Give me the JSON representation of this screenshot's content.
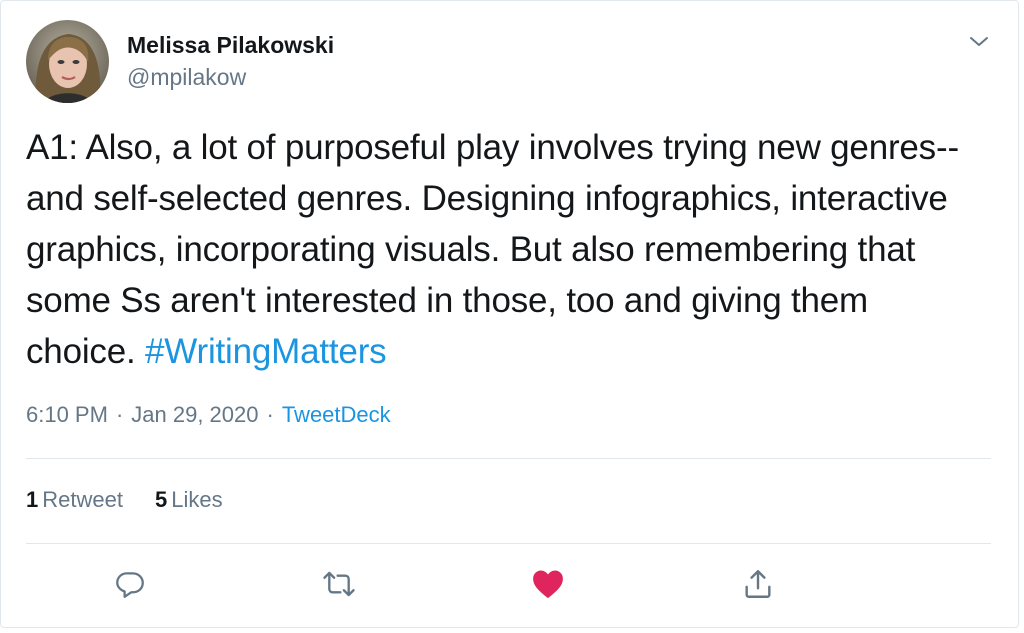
{
  "user": {
    "display_name": "Melissa Pilakowski",
    "handle": "@mpilakow"
  },
  "tweet": {
    "text": "A1: Also, a lot of purposeful play involves trying new genres--and self-selected genres. Designing infographics, interactive graphics, incorporating visuals. But also remembering that some Ss aren't interested in those, too and giving them choice. ",
    "hashtag": "#WritingMatters"
  },
  "meta": {
    "time": "6:10 PM",
    "separator": "·",
    "date": "Jan 29, 2020",
    "source": "TweetDeck"
  },
  "stats": {
    "retweets_count": "1",
    "retweets_label": "Retweet",
    "likes_count": "5",
    "likes_label": "Likes"
  },
  "actions": {
    "reply_icon": "reply-icon",
    "retweet_icon": "retweet-icon",
    "like_icon": "heart-icon",
    "share_icon": "share-icon",
    "like_color": "#e0245e"
  },
  "colors": {
    "link": "#1b95e0",
    "muted": "#657786",
    "text": "#14171a",
    "border": "#e1e8ed"
  }
}
